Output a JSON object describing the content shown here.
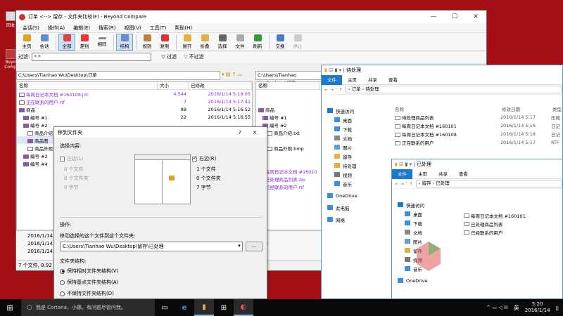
{
  "desktop": {
    "icons": [
      "回收",
      "Beyo",
      "Comp"
    ]
  },
  "bc": {
    "title": "订单 <--> 留存 - 文件夹比较(F) - Beyond Compare",
    "menu": [
      "会话(S)",
      "操作(A)",
      "编辑(E)",
      "搜索(R)",
      "视图(V)",
      "工具(T)",
      "帮助(H)"
    ],
    "toolbar": [
      "主页",
      "会话",
      "全部",
      "差别",
      "相同",
      "结构",
      "规则",
      "复制",
      "展开",
      "折叠",
      "选择",
      "文件",
      "刷新",
      "交换",
      "停止"
    ],
    "filter_label": "过滤:",
    "filter_value": "*.*",
    "filter_btn": "过滤",
    "nofilter_btn": "不过滤",
    "left_path": "C:\\Users\\Tianhao Wu\\Desktop\\订单",
    "right_path": "C:\\Users\\Tianhao Wu\\Desktop\\留存",
    "cols": {
      "name": "名称",
      "size": "大小",
      "modified": "已修改"
    },
    "left_rows": [
      {
        "name": "每周日记本文档 #160108.jnt",
        "size": "4,544",
        "date": "2016/1/14 5:18:05",
        "purple": true,
        "kind": "doc"
      },
      {
        "name": "正在联系的用户.rtf",
        "size": "7",
        "date": "2016/1/14 5:17:42",
        "purple": true,
        "kind": "doc"
      },
      {
        "name": "商品",
        "size": "88",
        "date": "2016/1/14 5:16:52",
        "purple": false,
        "kind": "fol"
      },
      {
        "name": "编号 #1",
        "size": "22",
        "date": "2016/1/14 5:16:55",
        "purple": false,
        "kind": "fol"
      },
      {
        "name": "编号 #2",
        "size": "",
        "date": "",
        "purple": false,
        "kind": "fol"
      },
      {
        "name": "商品介绍",
        "size": "",
        "date": "",
        "purple": false,
        "kind": "doc"
      },
      {
        "name": "商品图",
        "size": "",
        "date": "",
        "purple": false,
        "kind": "fol"
      },
      {
        "name": "商品外观",
        "size": "",
        "date": "",
        "purple": false,
        "kind": "doc"
      },
      {
        "name": "编号 #3",
        "size": "",
        "date": "",
        "purple": false,
        "kind": "fol"
      },
      {
        "name": "编号 #4",
        "size": "",
        "date": "",
        "purple": false,
        "kind": "fol"
      }
    ],
    "right_rows": [
      {
        "name": "",
        "purple": false,
        "kind": ""
      },
      {
        "name": "",
        "purple": false,
        "kind": ""
      },
      {
        "name": "商品",
        "purple": false,
        "kind": "fol"
      },
      {
        "name": "编号 #1",
        "purple": false,
        "kind": "fol"
      },
      {
        "name": "编号 #2",
        "purple": false,
        "kind": "fol"
      },
      {
        "name": "商品介绍.txt",
        "purple": false,
        "kind": "doc"
      },
      {
        "name": "",
        "purple": false,
        "kind": ""
      },
      {
        "name": "商品外观.bmp",
        "purple": false,
        "kind": "doc"
      },
      {
        "name": "",
        "purple": false,
        "kind": ""
      },
      {
        "name": "",
        "purple": false,
        "kind": ""
      },
      {
        "name": "每周日记本文档 #16010",
        "purple": true,
        "kind": "doc"
      },
      {
        "name": "已处理商品列表.zip",
        "purple": true,
        "kind": "doc"
      },
      {
        "name": "已经联系的用户.rtf",
        "purple": true,
        "kind": "doc"
      }
    ],
    "bottom_dates": [
      "2016/1/14",
      "2016/1/14",
      "2016/1/14"
    ],
    "right_bottom": "留存",
    "status": "7 个文件, 8.92 KB"
  },
  "dlg": {
    "title": "移到文件夹",
    "help": "?",
    "close": "✕",
    "select_label": "选择内容:",
    "left_opt": "左边(L)",
    "left_files": "0 个文件",
    "left_folders": "0 个文件夹",
    "left_bytes": "0 字节",
    "right_opt": "右边(R)",
    "right_files": "1 个文件",
    "right_folders": "0 个文件夹",
    "right_bytes": "7 字节",
    "ops_label": "操作:",
    "move_label": "移动选择的这个文件到这个文件夹:",
    "dest": "C:\\Users\\Tianhao Wu\\Desktop\\留存\\已处理",
    "struct_label": "文件夹结构:",
    "opt1": "保持相对文件夹结构(V)",
    "opt2": "保持基点文件夹结构(A)",
    "opt3": "不保持文件夹结构(D)"
  },
  "exp1": {
    "title": "待处理",
    "tabs": [
      "文件",
      "主页",
      "共享",
      "查看"
    ],
    "crumbs": "› 订单 › 待处理",
    "nav": [
      "快速访问",
      "桌面",
      "下载",
      "文档",
      "图片",
      "留存",
      "待处理",
      "视频",
      "音乐",
      "OneDrive",
      "此电脑",
      "网络"
    ],
    "cols": {
      "name": "名称",
      "modified": "修改日期",
      "type": "类型"
    },
    "files": [
      {
        "name": "待处理商品列表",
        "date": "2016/1/14 5:17",
        "type": "压缩"
      },
      {
        "name": "每周日记本文档 #160101",
        "date": "2016/1/14 5:16",
        "type": "日记"
      },
      {
        "name": "每周日记本文档 #160108",
        "date": "2016/1/14 5:18",
        "type": "日记"
      },
      {
        "name": "正在联系的用户",
        "date": "2016/1/14 5:17",
        "type": "RTF"
      }
    ]
  },
  "exp2": {
    "title": "已处理",
    "tabs": [
      "文件",
      "主页",
      "共享",
      "查看"
    ],
    "crumbs": "› 留存 › 已处理",
    "nav": [
      "快速访问",
      "桌面",
      "下载",
      "文档",
      "图片",
      "留存",
      "视频",
      "音乐",
      "OneDrive"
    ],
    "files": [
      "每周日记本文档 #160101",
      "已处理商品列表",
      "已经联系的用户"
    ]
  },
  "taskbar": {
    "cortana": "我是 Cortana，小娜。有问题尽管问我。",
    "time": "5:20",
    "date": "2016/1/14",
    "ime": "英"
  },
  "watermark": {
    "cn": "数码荔枝",
    "url": "http://lizhi.io"
  }
}
